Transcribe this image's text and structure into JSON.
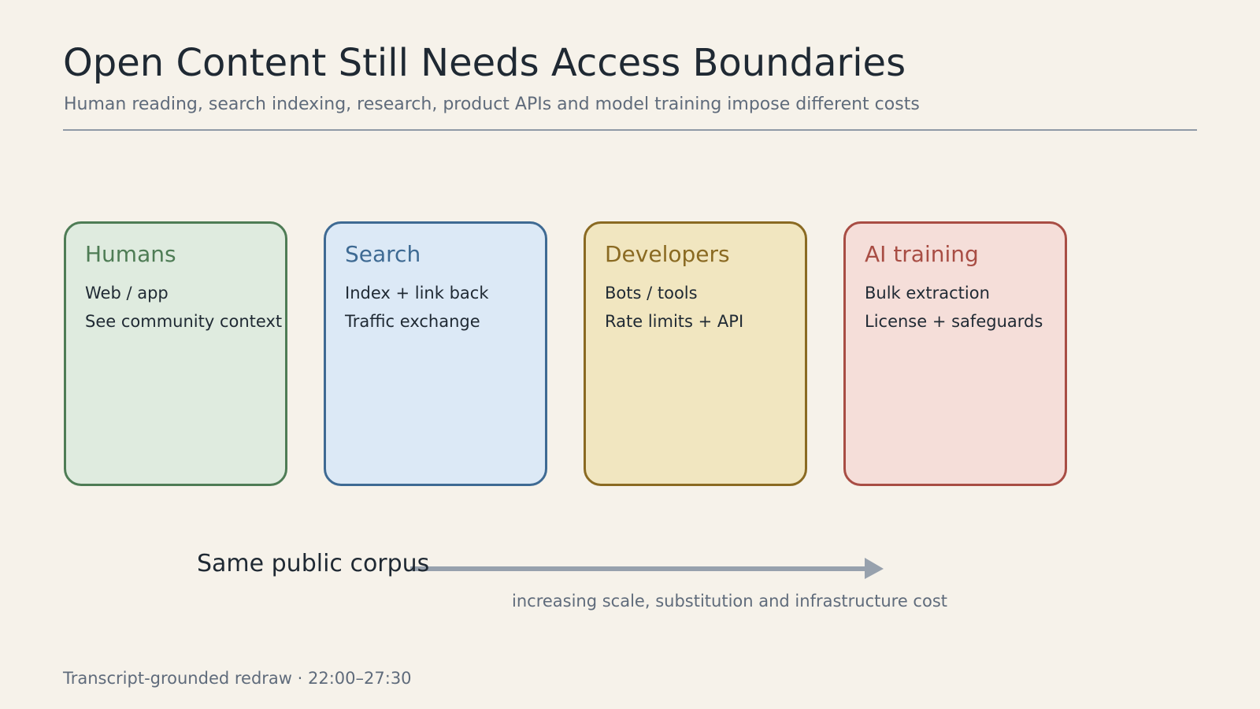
{
  "slide": {
    "title": "Open Content Still Needs Access Boundaries",
    "subtitle": "Human reading, search indexing, research, product APIs and model training impose different costs"
  },
  "cards": [
    {
      "title": "Humans",
      "lines": [
        "Web / app",
        "See community context"
      ],
      "accent": "#4e7c55",
      "fill": "#dfebdf"
    },
    {
      "title": "Search",
      "lines": [
        "Index + link back",
        "Traffic exchange"
      ],
      "accent": "#3e6a93",
      "fill": "#dce9f6"
    },
    {
      "title": "Developers",
      "lines": [
        "Bots / tools",
        "Rate limits + API"
      ],
      "accent": "#8a6a22",
      "fill": "#f1e6c0"
    },
    {
      "title": "AI training",
      "lines": [
        "Bulk extraction",
        "License + safeguards"
      ],
      "accent": "#a84d44",
      "fill": "#f5ded9"
    }
  ],
  "flow": {
    "label": "Same public corpus",
    "caption": "increasing scale, substitution and infrastructure cost",
    "arrow_color": "#97a1ad"
  },
  "footer": {
    "text": "Transcript-grounded redraw · 22:00–27:30"
  }
}
